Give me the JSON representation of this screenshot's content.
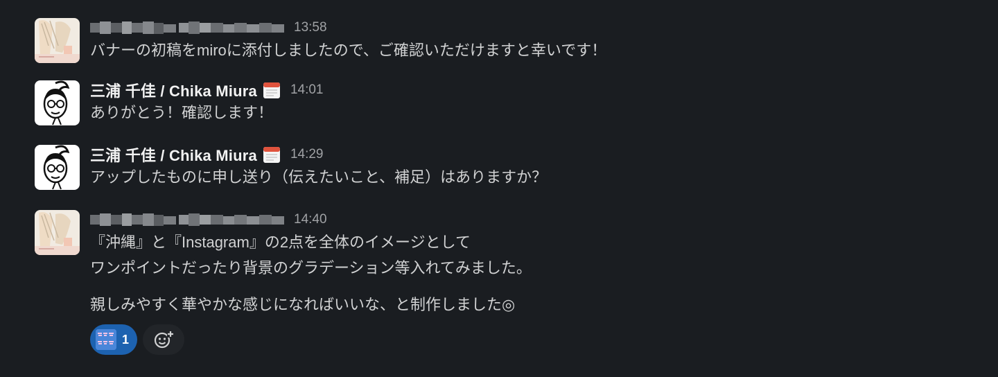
{
  "messages": [
    {
      "author": "",
      "time": "13:58",
      "lines": [
        "バナーの初稿をmiroに添付しましたので、ご確認いただけますと幸いです！"
      ]
    },
    {
      "author": "三浦 千佳 / Chika Miura",
      "time": "14:01",
      "lines": [
        "ありがとう！確認します！"
      ]
    },
    {
      "author": "三浦 千佳 / Chika Miura",
      "time": "14:29",
      "lines": [
        "アップしたものに申し送り（伝えたいこと、補足）はありますか？"
      ]
    },
    {
      "author": "",
      "time": "14:40",
      "lines": [
        "『沖縄』と『Instagram』の2点を全体のイメージとして",
        "ワンポイントだったり背景のグラデーション等入れてみました。",
        "親しみやすく華やかな感じになればいいな、と制作しました◎"
      ],
      "reaction": {
        "emoji_text": "顔晴ろう おおきに",
        "count": "1"
      }
    }
  ],
  "colors": {
    "background": "#1a1d21",
    "text": "#d1d2d3",
    "timestamp": "#a0a2a5",
    "reaction_bg": "#1d62b0"
  }
}
